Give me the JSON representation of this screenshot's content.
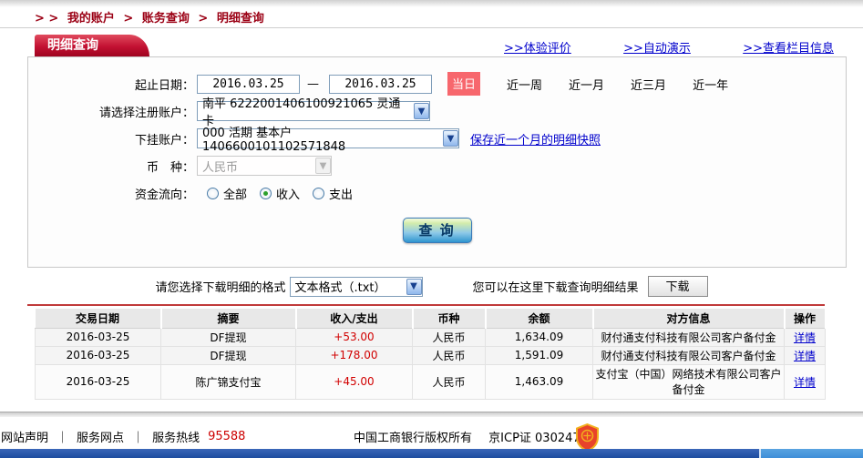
{
  "breadcrumb": {
    "prefix": "> >",
    "sep": ">",
    "items": [
      "我的账户",
      "账务查询",
      "明细查询"
    ]
  },
  "tab_title": "明细查询",
  "toolbar_links": {
    "experience": ">>体验评价",
    "demo": ">>自动演示",
    "column_info": ">>查看栏目信息"
  },
  "form": {
    "date_label": "起止日期：",
    "date_from": "2016.03.25",
    "date_dash": "—",
    "date_to": "2016.03.25",
    "today": "当日",
    "ranges": [
      "近一周",
      "近一月",
      "近三月",
      "近一年"
    ],
    "register_label": "请选择注册账户：",
    "register_value": "南平 6222001406100921065 灵通卡",
    "sub_label": "下挂账户：",
    "sub_value": "000 活期 基本户 1406600101102571848",
    "snapshot_link": "保存近一个月的明细快照",
    "currency_label": "币　种：",
    "currency_value": "人民币",
    "flow_label": "资金流向：",
    "flow": {
      "all": "全部",
      "income": "收入",
      "expense": "支出"
    },
    "query_btn": "查 询",
    "dropdown_arrow": "▼"
  },
  "download": {
    "format_label": "请您选择下载明细的格式",
    "format_value": "文本格式（.txt）",
    "hint": "您可以在这里下载查询明细结果",
    "btn": "下载"
  },
  "table": {
    "headers": [
      "交易日期",
      "摘要",
      "收入/支出",
      "币种",
      "余额",
      "对方信息",
      "操作"
    ],
    "rows": [
      {
        "date": "2016-03-25",
        "summary": "DF提现",
        "amount": "+53.00",
        "currency": "人民币",
        "balance": "1,634.09",
        "party": "财付通支付科技有限公司客户备付金",
        "action": "详情"
      },
      {
        "date": "2016-03-25",
        "summary": "DF提现",
        "amount": "+178.00",
        "currency": "人民币",
        "balance": "1,591.09",
        "party": "财付通支付科技有限公司客户备付金",
        "action": "详情"
      },
      {
        "date": "2016-03-25",
        "summary": "陈广锦支付宝",
        "amount": "+45.00",
        "currency": "人民币",
        "balance": "1,463.09",
        "party": "支付宝（中国）网络技术有限公司客户备付金",
        "action": "详情"
      }
    ]
  },
  "footer": {
    "site_statement": "网站声明",
    "service_branch": "服务网点",
    "sep": "｜",
    "hotline_label": "服务热线",
    "hotline_number": "95588",
    "copyright": "中国工商银行版权所有",
    "icp": "京ICP证 030247号"
  },
  "colors": {
    "tab_red": "#c31132",
    "link_blue": "#0000cc",
    "badge_red": "#f7676d",
    "amount_red": "#d10000",
    "breadcrumb_red": "#9b0014"
  }
}
